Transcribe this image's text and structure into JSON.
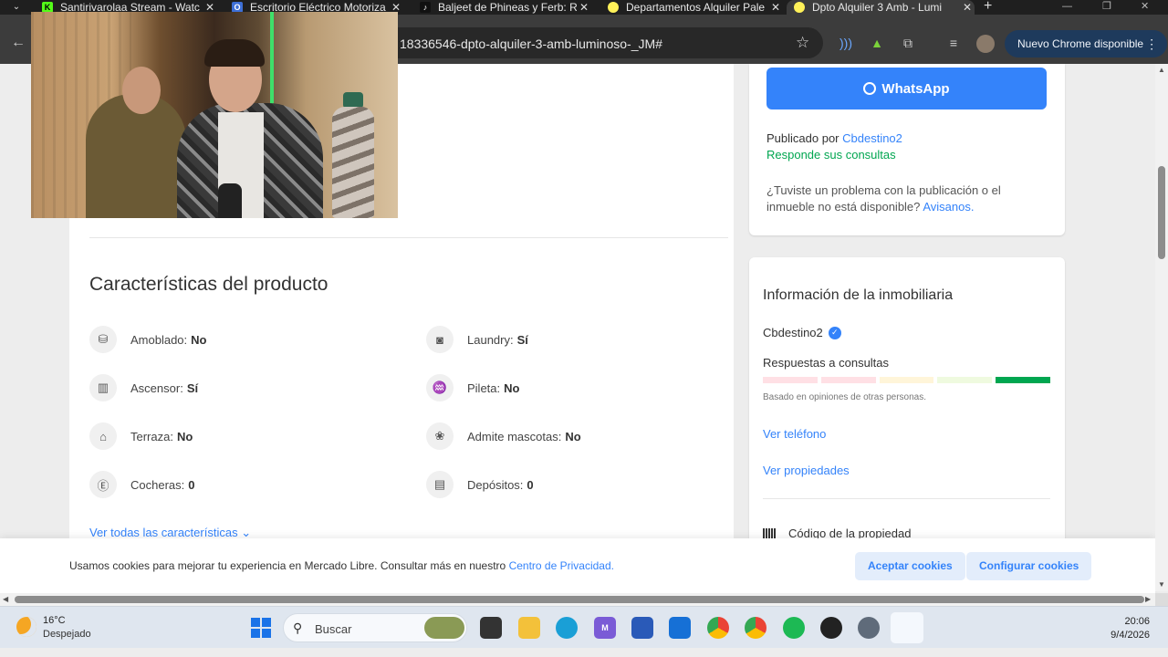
{
  "browser": {
    "tabs": [
      {
        "title": "Santirivarolaa Stream - Watc",
        "favicon": "K",
        "favicon_color": "#53fc18",
        "active": false
      },
      {
        "title": "Escritorio Eléctrico Motoriza",
        "favicon": "O",
        "favicon_color": "#3d6fd6",
        "active": false
      },
      {
        "title": "Baljeet de Phineas y Ferb: Re",
        "favicon": "♪",
        "favicon_color": "#111111",
        "active": false
      },
      {
        "title": "Departamentos Alquiler Pale",
        "favicon": "•",
        "favicon_color": "#fff159",
        "active": false
      },
      {
        "title": "Dpto Alquiler 3 Amb - Lumi",
        "favicon": "•",
        "favicon_color": "#fff159",
        "active": true
      }
    ],
    "url": "18336546-dpto-alquiler-3-amb-luminoso-_JM#",
    "update_label": "Nuevo Chrome disponible"
  },
  "contact": {
    "whatsapp_label": "WhatsApp",
    "published_by_prefix": "Publicado por",
    "publisher": "Cbdestino2",
    "responds": "Responde sus consultas",
    "problem_text": "¿Tuviste un problema con la publicación o el inmueble no está disponible?",
    "problem_link": "Avisanos."
  },
  "features": {
    "title": "Características del producto",
    "items": [
      {
        "label": "Amoblado:",
        "value": "No",
        "icon": "sofa-icon"
      },
      {
        "label": "Laundry:",
        "value": "Sí",
        "icon": "washer-icon"
      },
      {
        "label": "Ascensor:",
        "value": "Sí",
        "icon": "elevator-icon"
      },
      {
        "label": "Pileta:",
        "value": "No",
        "icon": "pool-icon"
      },
      {
        "label": "Terraza:",
        "value": "No",
        "icon": "terrace-icon"
      },
      {
        "label": "Admite mascotas:",
        "value": "No",
        "icon": "paw-icon"
      },
      {
        "label": "Cocheras:",
        "value": "0",
        "icon": "parking-icon"
      },
      {
        "label": "Depósitos:",
        "value": "0",
        "icon": "storage-box-icon"
      }
    ],
    "see_all": "Ver todas las características"
  },
  "agency": {
    "title": "Información de la inmobiliaria",
    "name": "Cbdestino2",
    "responses_label": "Respuestas a consultas",
    "thermometer_level": 5,
    "thermometer_colors": [
      "#ffe0e5",
      "#ffe0e5",
      "#fff5d9",
      "#effadf",
      "#00a650"
    ],
    "based_on": "Basado en opiniones de otras personas.",
    "phone_link": "Ver teléfono",
    "properties_link": "Ver propiedades",
    "code_label": "Código de la propiedad"
  },
  "cookies": {
    "text": "Usamos cookies para mejorar tu experiencia en Mercado Libre. Consultar más en nuestro",
    "link": "Centro de Privacidad.",
    "accept": "Aceptar cookies",
    "configure": "Configurar cookies"
  },
  "taskbar": {
    "temperature": "16°C",
    "weather": "Despejado",
    "search": "Buscar",
    "time": "20:06",
    "date": "9/4/2026"
  },
  "colors": {
    "accent": "#3483fa",
    "success": "#00a650"
  }
}
